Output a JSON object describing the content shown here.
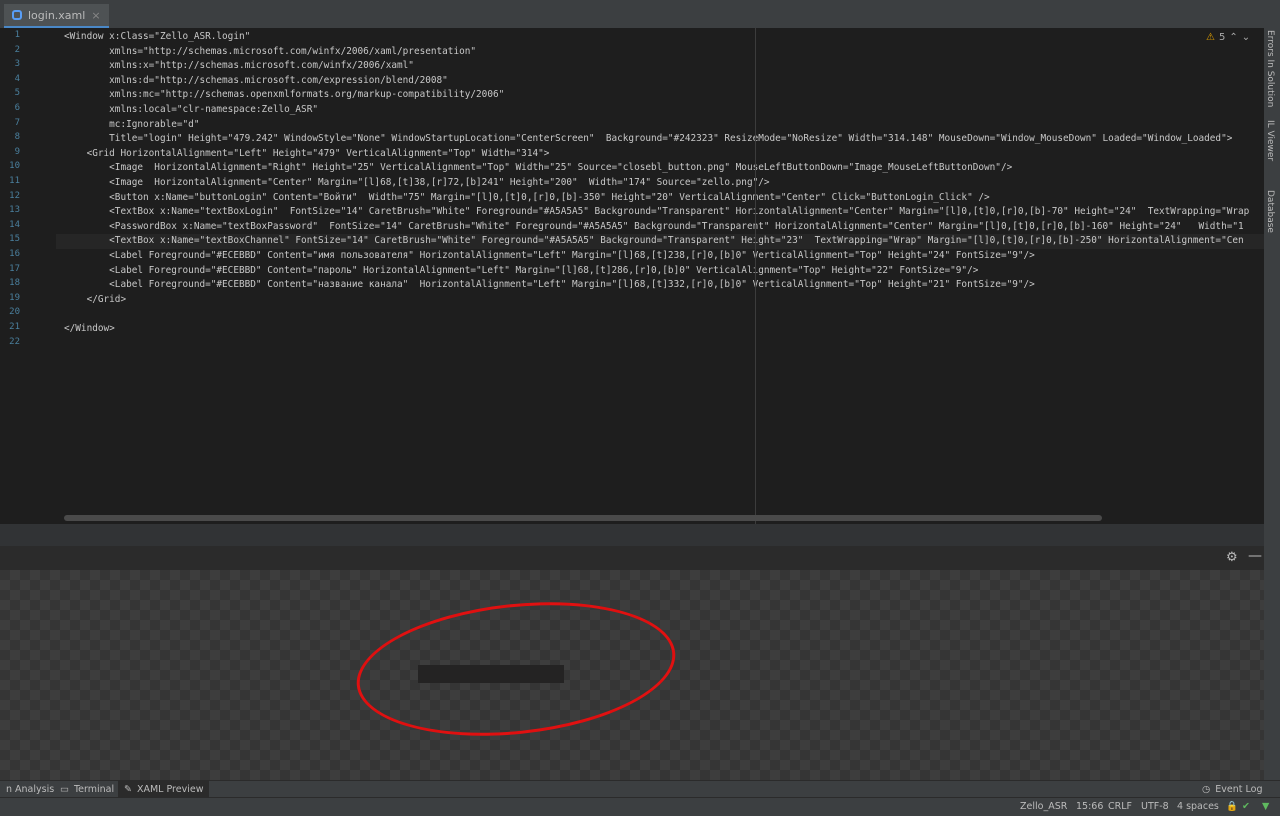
{
  "tab": {
    "file_name": "login.xaml",
    "close_icon": "×"
  },
  "warnings": {
    "count": "5"
  },
  "right_tabs": [
    "Errors In Solution",
    "IL Viewer",
    "Database"
  ],
  "code_lines": [
    {
      "num": "1",
      "text": "<Window x:Class=\"Zello_ASR.login\""
    },
    {
      "num": "2",
      "text": "        xmlns=\"http://schemas.microsoft.com/winfx/2006/xaml/presentation\""
    },
    {
      "num": "3",
      "text": "        xmlns:x=\"http://schemas.microsoft.com/winfx/2006/xaml\""
    },
    {
      "num": "4",
      "text": "        xmlns:d=\"http://schemas.microsoft.com/expression/blend/2008\""
    },
    {
      "num": "5",
      "text": "        xmlns:mc=\"http://schemas.openxmlformats.org/markup-compatibility/2006\""
    },
    {
      "num": "6",
      "text": "        xmlns:local=\"clr-namespace:Zello_ASR\""
    },
    {
      "num": "7",
      "text": "        mc:Ignorable=\"d\""
    },
    {
      "num": "8",
      "text": "        Title=\"login\" Height=\"479.242\" WindowStyle=\"None\" WindowStartupLocation=\"CenterScreen\"  Background=\"#242323\" ResizeMode=\"NoResize\" Width=\"314.148\" MouseDown=\"Window_MouseDown\" Loaded=\"Window_Loaded\">"
    },
    {
      "num": "9",
      "text": "    <Grid HorizontalAlignment=\"Left\" Height=\"479\" VerticalAlignment=\"Top\" Width=\"314\">"
    },
    {
      "num": "10",
      "text": "        <Image  HorizontalAlignment=\"Right\" Height=\"25\" VerticalAlignment=\"Top\" Width=\"25\" Source=\"closebl_button.png\" MouseLeftButtonDown=\"Image_MouseLeftButtonDown\"/>"
    },
    {
      "num": "11",
      "text": "        <Image  HorizontalAlignment=\"Center\" Margin=\"[l]68,[t]38,[r]72,[b]241\" Height=\"200\"  Width=\"174\" Source=\"zello.png\"/>"
    },
    {
      "num": "12",
      "text": "        <Button x:Name=\"buttonLogin\" Content=\"Войти\"  Width=\"75\" Margin=\"[l]0,[t]0,[r]0,[b]-350\" Height=\"20\" VerticalAlignment=\"Center\" Click=\"ButtonLogin_Click\" />"
    },
    {
      "num": "13",
      "text": "        <TextBox x:Name=\"textBoxLogin\"  FontSize=\"14\" CaretBrush=\"White\" Foreground=\"#A5A5A5\" Background=\"Transparent\" HorizontalAlignment=\"Center\" Margin=\"[l]0,[t]0,[r]0,[b]-70\" Height=\"24\"  TextWrapping=\"Wrap"
    },
    {
      "num": "14",
      "text": "        <PasswordBox x:Name=\"textBoxPassword\"  FontSize=\"14\" CaretBrush=\"White\" Foreground=\"#A5A5A5\" Background=\"Transparent\" HorizontalAlignment=\"Center\" Margin=\"[l]0,[t]0,[r]0,[b]-160\" Height=\"24\"   Width=\"1"
    },
    {
      "num": "15",
      "text": "        <TextBox x:Name=\"textBoxChannel\" FontSize=\"14\" CaretBrush=\"White\" Foreground=\"#A5A5A5\" Background=\"Transparent\" Height=\"23\"  TextWrapping=\"Wrap\" Margin=\"[l]0,[t]0,[r]0,[b]-250\" HorizontalAlignment=\"Cen"
    },
    {
      "num": "16",
      "text": "        <Label Foreground=\"#ECEBBD\" Content=\"имя пользователя\" HorizontalAlignment=\"Left\" Margin=\"[l]68,[t]238,[r]0,[b]0\" VerticalAlignment=\"Top\" Height=\"24\" FontSize=\"9\"/>"
    },
    {
      "num": "17",
      "text": "        <Label Foreground=\"#ECEBBD\" Content=\"пароль\" HorizontalAlignment=\"Left\" Margin=\"[l]68,[t]286,[r]0,[b]0\" VerticalAlignment=\"Top\" Height=\"22\" FontSize=\"9\"/>"
    },
    {
      "num": "18",
      "text": "        <Label Foreground=\"#ECEBBD\" Content=\"название канала\"  HorizontalAlignment=\"Left\" Margin=\"[l]68,[t]332,[r]0,[b]0\" VerticalAlignment=\"Top\" Height=\"21\" FontSize=\"9\"/>"
    },
    {
      "num": "19",
      "text": "    </Grid>"
    },
    {
      "num": "20",
      "text": ""
    },
    {
      "num": "21",
      "text": "</Window>"
    },
    {
      "num": "22",
      "text": ""
    }
  ],
  "bottom_tabs": [
    {
      "label": "n Analysis",
      "icon": ""
    },
    {
      "label": "Terminal",
      "icon": "terminal-icon"
    },
    {
      "label": "XAML Preview",
      "icon": "xaml-preview-icon"
    }
  ],
  "event_log": "Event Log",
  "status": {
    "project": "Zello_ASR",
    "position": "15:66",
    "line_endings": "CRLF",
    "encoding": "UTF-8",
    "indent": "4 spaces"
  },
  "colors": {
    "accent": "#4a88c7",
    "annotation_circle": "#e01010",
    "preview_window_bg": "#242323"
  }
}
